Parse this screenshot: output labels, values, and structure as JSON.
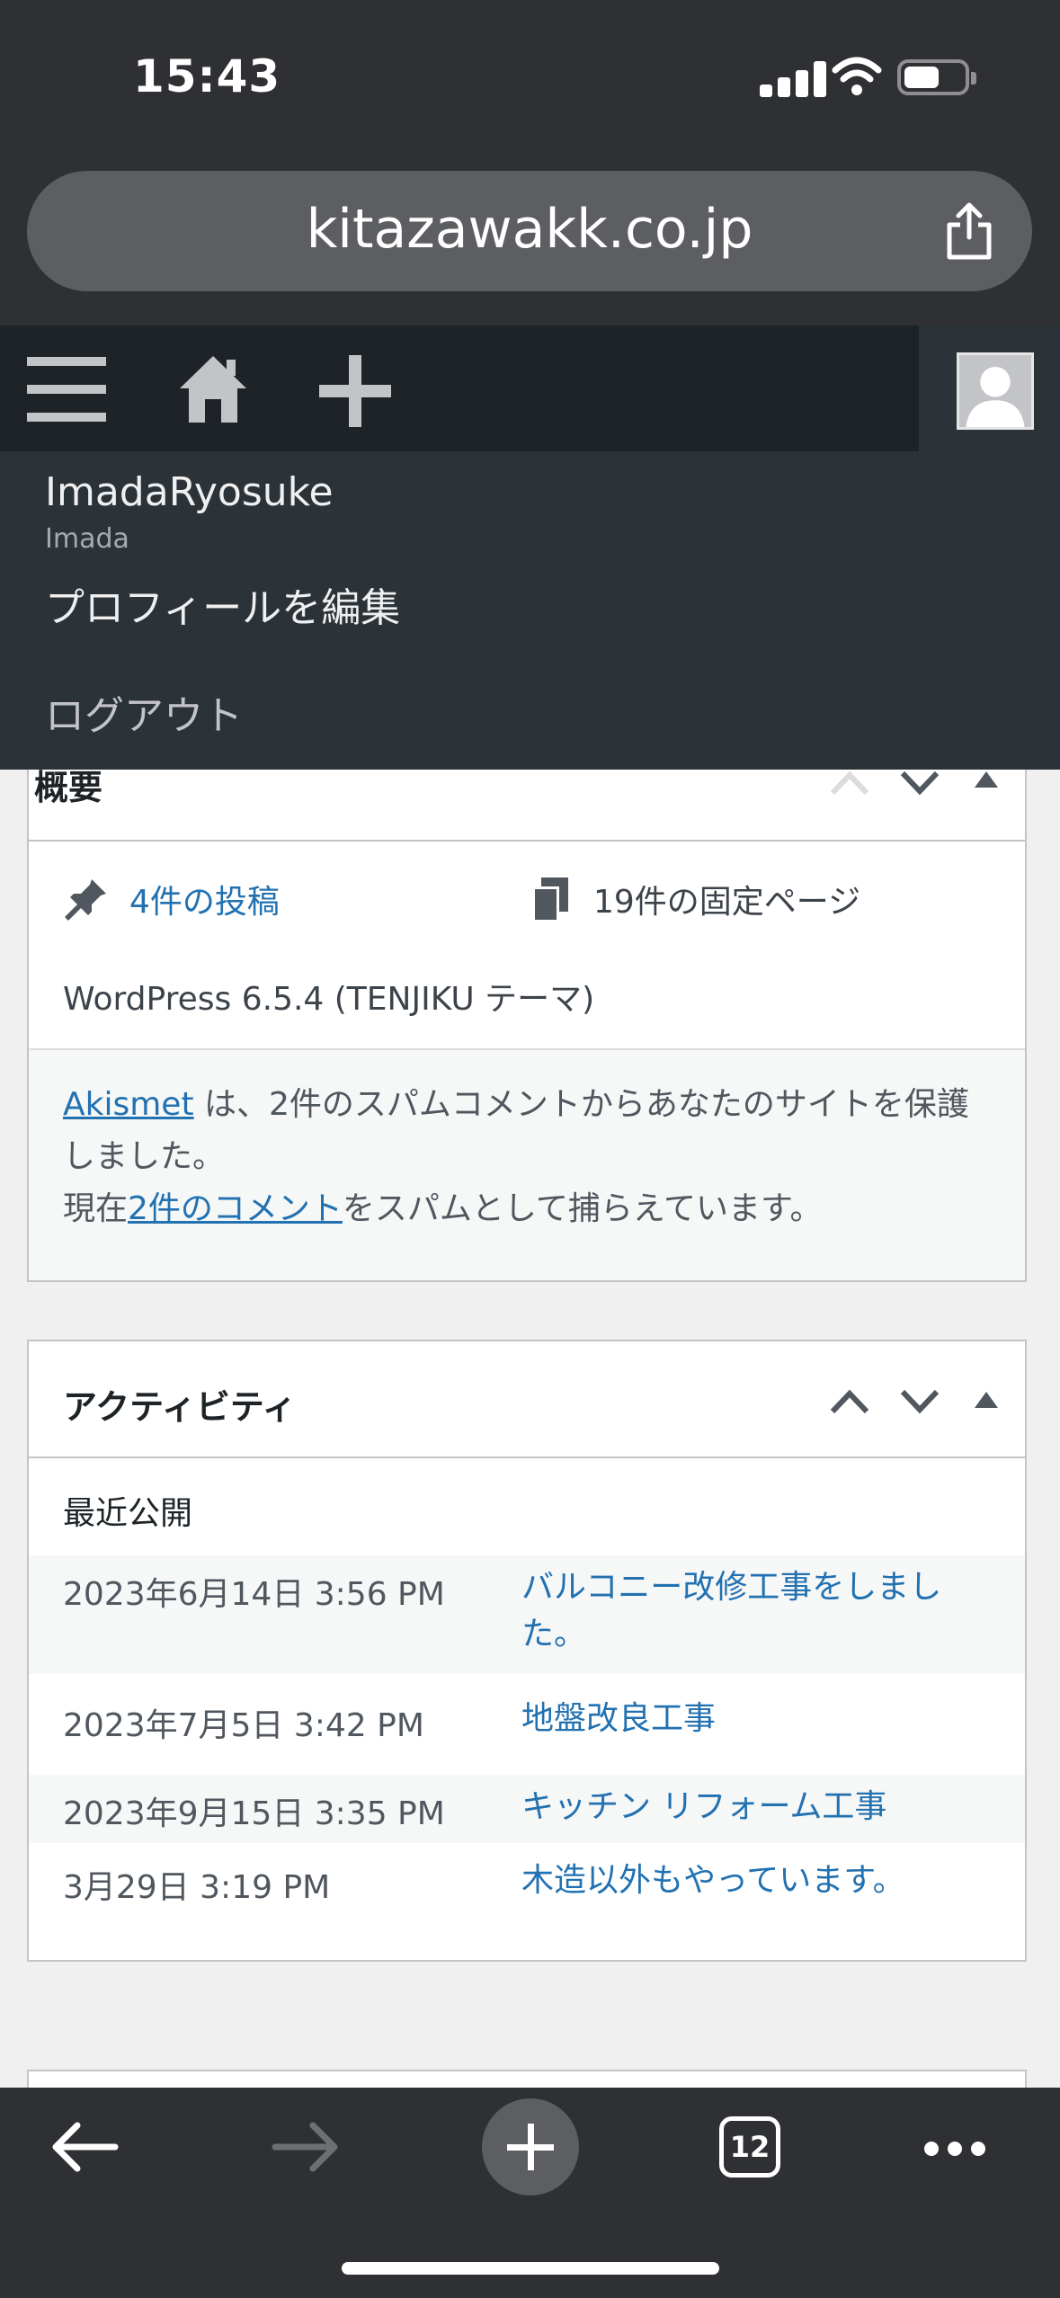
{
  "status": {
    "time": "15:43"
  },
  "browser": {
    "url": "kitazawakk.co.jp",
    "tab_count": "12"
  },
  "user_menu": {
    "display_name": "ImadaRyosuke",
    "username": "Imada",
    "edit_profile": "プロフィールを編集",
    "logout": "ログアウト"
  },
  "glance": {
    "title": "概要",
    "posts": "4件の投稿",
    "pages": "19件の固定ページ",
    "version": "WordPress 6.5.4 (TENJIKU テーマ)",
    "akismet_link": "Akismet",
    "akismet_line1_rest": " は、2件のスパムコメントからあなたのサイトを保護",
    "akismet_line2": "しました。",
    "akismet_line3_pre": "現在",
    "akismet_line3_link": "2件のコメント",
    "akismet_line3_post": "をスパムとして捕らえています。"
  },
  "activity": {
    "title": "アクティビティ",
    "section": "最近公開",
    "items": [
      {
        "date": "2023年6月14日 3:56 PM",
        "title_line1": "バルコニー改修工事をしまし",
        "title_line2": "た。"
      },
      {
        "date": "2023年7月5日 3:42 PM",
        "title": "地盤改良工事"
      },
      {
        "date": "2023年9月15日 3:35 PM",
        "title": "キッチン リフォーム工事"
      },
      {
        "date": "3月29日 3:19 PM",
        "title": "木造以外もやっています。"
      }
    ]
  },
  "colors": {
    "link": "#2271b1",
    "adminbar": "#1d2327",
    "dropdown": "#2c3338"
  }
}
